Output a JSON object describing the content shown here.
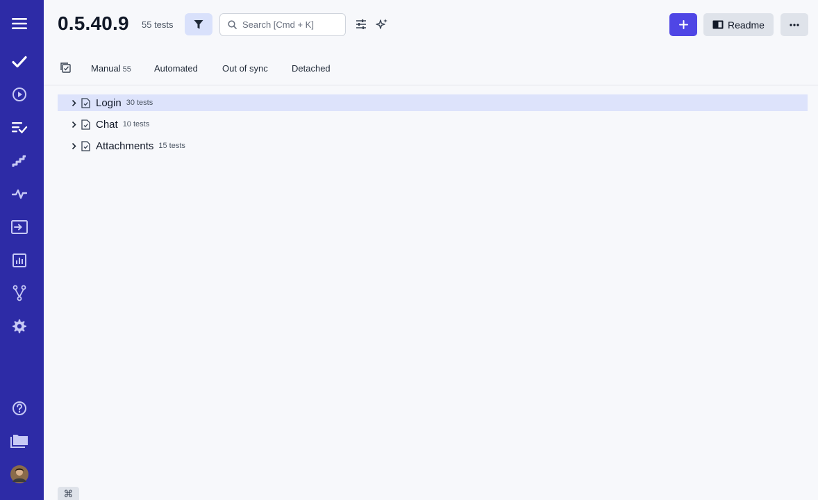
{
  "header": {
    "title": "0.5.40.9",
    "test_count": "55 tests",
    "search_placeholder": "Search [Cmd + K]",
    "readme_label": "Readme"
  },
  "tabs": [
    {
      "label": "Manual",
      "badge": "55"
    },
    {
      "label": "Automated"
    },
    {
      "label": "Out of sync"
    },
    {
      "label": "Detached"
    }
  ],
  "tree": [
    {
      "name": "Login",
      "count": "30 tests",
      "selected": true
    },
    {
      "name": "Chat",
      "count": "10 tests"
    },
    {
      "name": "Attachments",
      "count": "15 tests"
    }
  ],
  "sidebar": {
    "items": [
      "menu-icon",
      "check-icon",
      "play-circle-icon",
      "list-check-icon",
      "stairs-icon",
      "pulse-icon",
      "import-icon",
      "bar-chart-icon",
      "branch-icon",
      "gear-icon",
      "help-icon",
      "folders-icon",
      "avatar"
    ]
  },
  "footer": {
    "shortcut_key": "⌘"
  },
  "colors": {
    "sidebar": "#2d2ba6",
    "primary": "#4f46e5",
    "selected_row": "#dde3fb"
  }
}
